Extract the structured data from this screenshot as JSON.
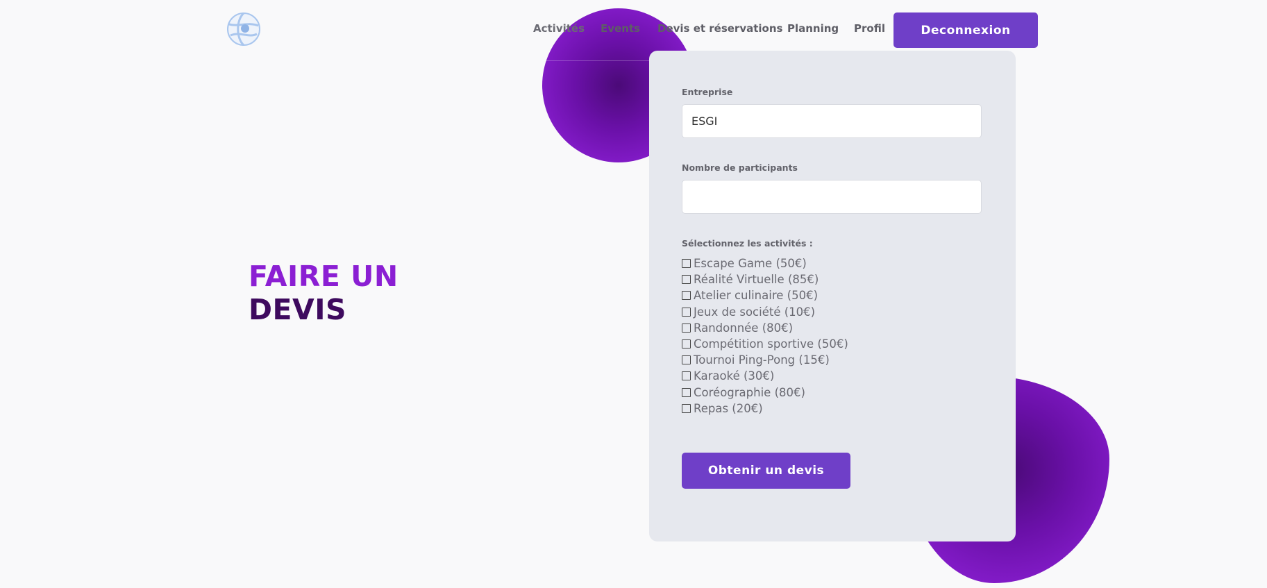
{
  "nav": {
    "links": [
      "Activités",
      "Events",
      "Devis et réservations",
      "Planning",
      "Profil"
    ],
    "logout_label": "Deconnexion",
    "logo_icon": "globe-logo-icon"
  },
  "hero": {
    "line1": "FAIRE UN",
    "line2": "DEVIS"
  },
  "form": {
    "company_label": "Entreprise",
    "company_value": "ESGI",
    "participants_label": "Nombre de participants",
    "participants_value": "",
    "activities_label": "Sélectionnez les activités :",
    "activities": [
      {
        "label": "Escape Game (50€)",
        "checked": false
      },
      {
        "label": "Réalité Virtuelle (85€)",
        "checked": false
      },
      {
        "label": "Atelier culinaire (50€)",
        "checked": false
      },
      {
        "label": "Jeux de société (10€)",
        "checked": false
      },
      {
        "label": "Randonnée (80€)",
        "checked": false
      },
      {
        "label": "Compétition sportive (50€)",
        "checked": false
      },
      {
        "label": "Tournoi Ping-Pong (15€)",
        "checked": false
      },
      {
        "label": "Karaoké (30€)",
        "checked": false
      },
      {
        "label": "Coréographie (80€)",
        "checked": false
      },
      {
        "label": "Repas (20€)",
        "checked": false
      }
    ],
    "submit_label": "Obtenir un devis"
  },
  "colors": {
    "accent": "#6f3fc8",
    "hero_purple": "#8b1fd3",
    "hero_dark": "#3e0a5e",
    "card_bg": "#e6e8ee"
  }
}
